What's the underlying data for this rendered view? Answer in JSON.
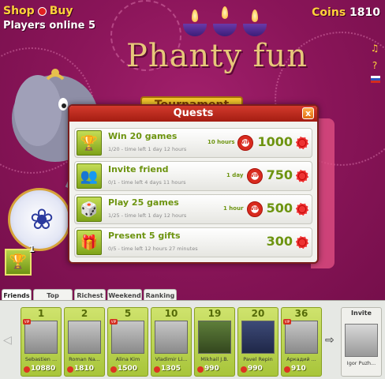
{
  "header": {
    "shop_label": "Shop",
    "buy_label": "Buy",
    "players_online": "Players online 5",
    "coins_label": "Coins",
    "coins_value": "1810"
  },
  "title": "Phanty fun",
  "tournament_label": "Tournament",
  "trophy_count": "1",
  "dialog": {
    "title": "Quests",
    "close_symbol": "x",
    "quests": [
      {
        "title": "Win 20 games",
        "sub": "1/20 - time left 1 day 12 hours",
        "time": "10 hours",
        "vip": "VIP",
        "reward": "1000",
        "icon": "trophy-icon"
      },
      {
        "title": "Invite friend",
        "sub": "0/1 - time left 4 days 11 hours",
        "time": "1 day",
        "vip": "VIP",
        "reward": "750",
        "icon": "users-icon"
      },
      {
        "title": "Play 25 games",
        "sub": "1/25 - time left 1 day 12 hours",
        "time": "1 hour",
        "vip": "VIP",
        "reward": "500",
        "icon": "dice-icon"
      },
      {
        "title": "Present 5 gifts",
        "sub": "0/5 - time left 12 hours 27 minutes",
        "time": "",
        "vip": "",
        "reward": "300",
        "icon": "gift-icon"
      }
    ]
  },
  "tabs": [
    "Friends",
    "Top games",
    "Richest",
    "Weekend",
    "Ranking"
  ],
  "friends": [
    {
      "rank": "1",
      "name": "Sebastien ...",
      "score": "10880"
    },
    {
      "rank": "2",
      "name": "Roman Na...",
      "score": "1810"
    },
    {
      "rank": "5",
      "name": "Alina Kim",
      "score": "1500"
    },
    {
      "rank": "10",
      "name": "Vladimir Li...",
      "score": "1305"
    },
    {
      "rank": "19",
      "name": "Mikhail J.B.",
      "score": "990"
    },
    {
      "rank": "20",
      "name": "Pavel Repin",
      "score": "990"
    },
    {
      "rank": "36",
      "name": "Аркадий ...",
      "score": "910"
    }
  ],
  "invite": {
    "label": "Invite",
    "name": "Igor Puzh..."
  },
  "colors": {
    "accent_green": "#6d9410",
    "header_red": "#c22c1f",
    "background": "#8a1559"
  }
}
